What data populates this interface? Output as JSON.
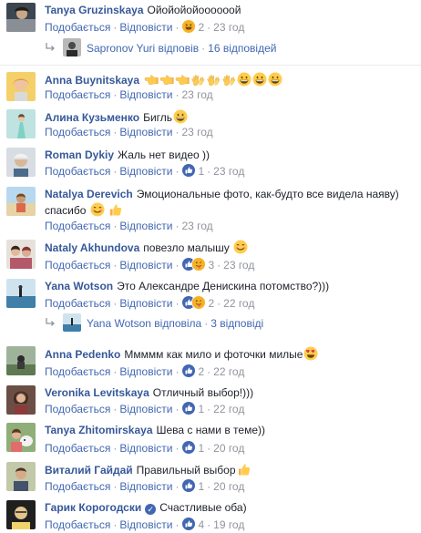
{
  "actions": {
    "like": "Подобається",
    "reply": "Відповісти",
    "dot": "·"
  },
  "colors": {
    "link": "#365899",
    "action": "#4267b2",
    "meta": "#90949c",
    "like_blue": "#4267b2",
    "haha_yellow": "#f7b125"
  },
  "comments": [
    {
      "author": "Tanya Gruzinskaya",
      "text": "Ойойойойоооооой",
      "reactions": [
        "haha-icon"
      ],
      "count": "2",
      "time": "23 год",
      "replies": {
        "name": "Sapronov Yuri",
        "verb": "відповів",
        "count_text": "16 відповідей"
      }
    },
    {
      "author": "Anna Buynitskaya",
      "text": "",
      "emojis": [
        "point-left-icon",
        "point-left-icon",
        "point-left-icon",
        "clap-icon",
        "clap-icon",
        "clap-icon",
        "grin-icon",
        "grin-icon",
        "grin-icon"
      ],
      "time": "23 год"
    },
    {
      "author": "Алина Кузьменко",
      "text": "Бигль",
      "emojis": [
        "grin-icon"
      ],
      "time": "23 год"
    },
    {
      "author": "Roman Dykiy",
      "text": "Жаль нет видео ))",
      "reactions": [
        "like-icon"
      ],
      "count": "1",
      "time": "23 год"
    },
    {
      "author": "Natalya Derevich",
      "text": "Эмоциональные фото, как-будто все видела наяву) спасибо",
      "emojis": [
        "smile-icon",
        "thumbs-up-icon"
      ],
      "time": "23 год"
    },
    {
      "author": "Nataly Akhundova",
      "text": "повезло малышу",
      "emojis": [
        "smile-icon"
      ],
      "reactions": [
        "like-icon",
        "wink-tongue-icon"
      ],
      "count": "3",
      "time": "23 год"
    },
    {
      "author": "Yana Wotson",
      "text": "Это Александре Денискина потомство?)))",
      "reactions": [
        "like-icon",
        "wink-tongue-icon"
      ],
      "count": "2",
      "time": "22 год",
      "replies": {
        "name": "Yana Wotson",
        "verb": "відповіла",
        "count_text": "3 відповіді"
      }
    },
    {
      "author": "Anna Pedenko",
      "text": "Ммммм как мило и фоточки милые",
      "emojis": [
        "heart-eyes-icon"
      ],
      "reactions": [
        "like-icon"
      ],
      "count": "2",
      "time": "22 год"
    },
    {
      "author": "Veronika Levitskaya",
      "text": "Отличный выбор!)))",
      "reactions": [
        "like-icon"
      ],
      "count": "1",
      "time": "22 год"
    },
    {
      "author": "Tanya Zhitomirskaya",
      "text": "Шева с нами в теме))",
      "reactions": [
        "like-icon"
      ],
      "count": "1",
      "time": "20 год"
    },
    {
      "author": "Виталий Гайдай",
      "text": "Правильный выбор",
      "emojis": [
        "thumbs-up-icon"
      ],
      "reactions": [
        "like-icon"
      ],
      "count": "1",
      "time": "20 год"
    },
    {
      "author": "Гарик Корогодски",
      "verified": "✓",
      "text": "Счастливые оба)",
      "reactions": [
        "like-icon"
      ],
      "count": "4",
      "time": "19 год"
    }
  ]
}
